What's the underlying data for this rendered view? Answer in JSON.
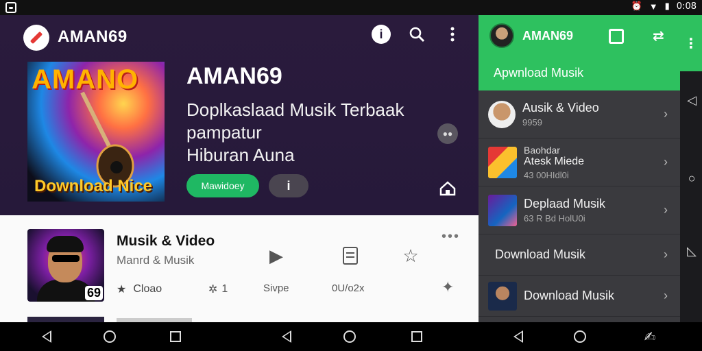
{
  "status_bar": {
    "time": "0:08"
  },
  "app": {
    "title": "AMAN69",
    "hero": {
      "cover_top": "AMANO",
      "cover_bottom": "Download Nice",
      "title": "AMAN69",
      "subtitle_lines": [
        "Doplkaslaad Musik Terbaak",
        "pampatur",
        "Hiburan Auna"
      ],
      "primary_button": "Mawidoey",
      "secondary_button": "i"
    },
    "card": {
      "title": "Musik & Video",
      "subtitle": "Manrd & Musik",
      "badge": "69",
      "rating_label": "Cloao",
      "stat_value": "1",
      "action_share_label": "Sivpe",
      "action_save_label": "0U/o2x"
    }
  },
  "drawer": {
    "user_name": "AMAN69",
    "header_subtitle": "Apwnload Musik",
    "items": [
      {
        "title": "Ausik & Video",
        "meta": "9959"
      },
      {
        "overline": "Baohdar",
        "title": "Atesk Miede",
        "meta": "43 00HIdl0i"
      },
      {
        "title": "Deplaad Musik",
        "meta": "63 R Bd HolU0i"
      },
      {
        "title": "Download Musik",
        "meta": ""
      },
      {
        "title": "Download Musik",
        "meta": ""
      }
    ]
  },
  "colors": {
    "accent_green": "#2ec15f",
    "hero_bg": "#2a1b3c",
    "drawer_bg": "#3a3a3e"
  }
}
